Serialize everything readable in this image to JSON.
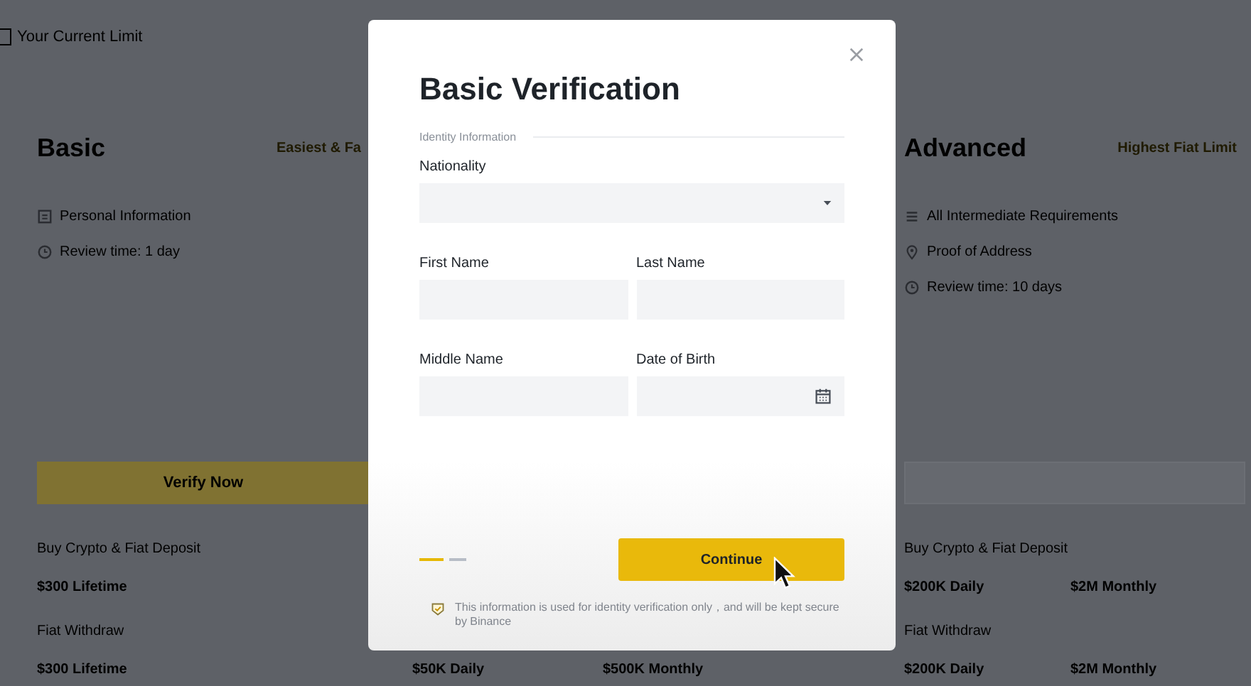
{
  "page": {
    "current_limit": "Your Current Limit"
  },
  "tiers": [
    {
      "name": "Basic",
      "tag": "Easiest & Fa",
      "requirements": [
        {
          "kind": "document",
          "text": "Personal Information"
        },
        {
          "kind": "clock",
          "text": "Review time: 1 day"
        }
      ],
      "button": {
        "kind": "primary",
        "label": "Verify Now"
      },
      "limits": [
        {
          "label": "Buy Crypto & Fiat Deposit",
          "values": [
            "$300 Lifetime"
          ]
        },
        {
          "label": "Fiat Withdraw",
          "values": [
            "$300 Lifetime"
          ]
        }
      ]
    },
    {
      "limits": [
        {
          "values": [
            "$50K Daily",
            "$500K Monthly"
          ]
        }
      ]
    },
    {
      "name": "Advanced",
      "tag": "Highest Fiat Limit",
      "requirements": [
        {
          "kind": "list",
          "text": "All Intermediate Requirements"
        },
        {
          "kind": "pin",
          "text": "Proof of Address"
        },
        {
          "kind": "clock",
          "text": "Review time: 10 days"
        }
      ],
      "button": {
        "kind": "disabled"
      },
      "limits": [
        {
          "label": "Buy Crypto & Fiat Deposit",
          "values": [
            "$200K Daily",
            "$2M Monthly"
          ]
        },
        {
          "label": "Fiat Withdraw",
          "values": [
            "$200K Daily",
            "$2M Monthly"
          ]
        }
      ]
    }
  ],
  "modal": {
    "title": "Basic Verification",
    "section": "Identity Information",
    "fields": [
      {
        "kind": "select",
        "label": "Nationality"
      },
      {
        "kind": "text",
        "label": "First Name"
      },
      {
        "kind": "text",
        "label": "Last Name"
      },
      {
        "kind": "text",
        "label": "Middle Name"
      },
      {
        "kind": "date",
        "label": "Date of Birth"
      }
    ],
    "steps": [
      {
        "selected": true
      },
      {
        "selected": false
      }
    ],
    "continue": "Continue",
    "note": "This information is used for identity verification only，and will be kept secure by Binance"
  }
}
